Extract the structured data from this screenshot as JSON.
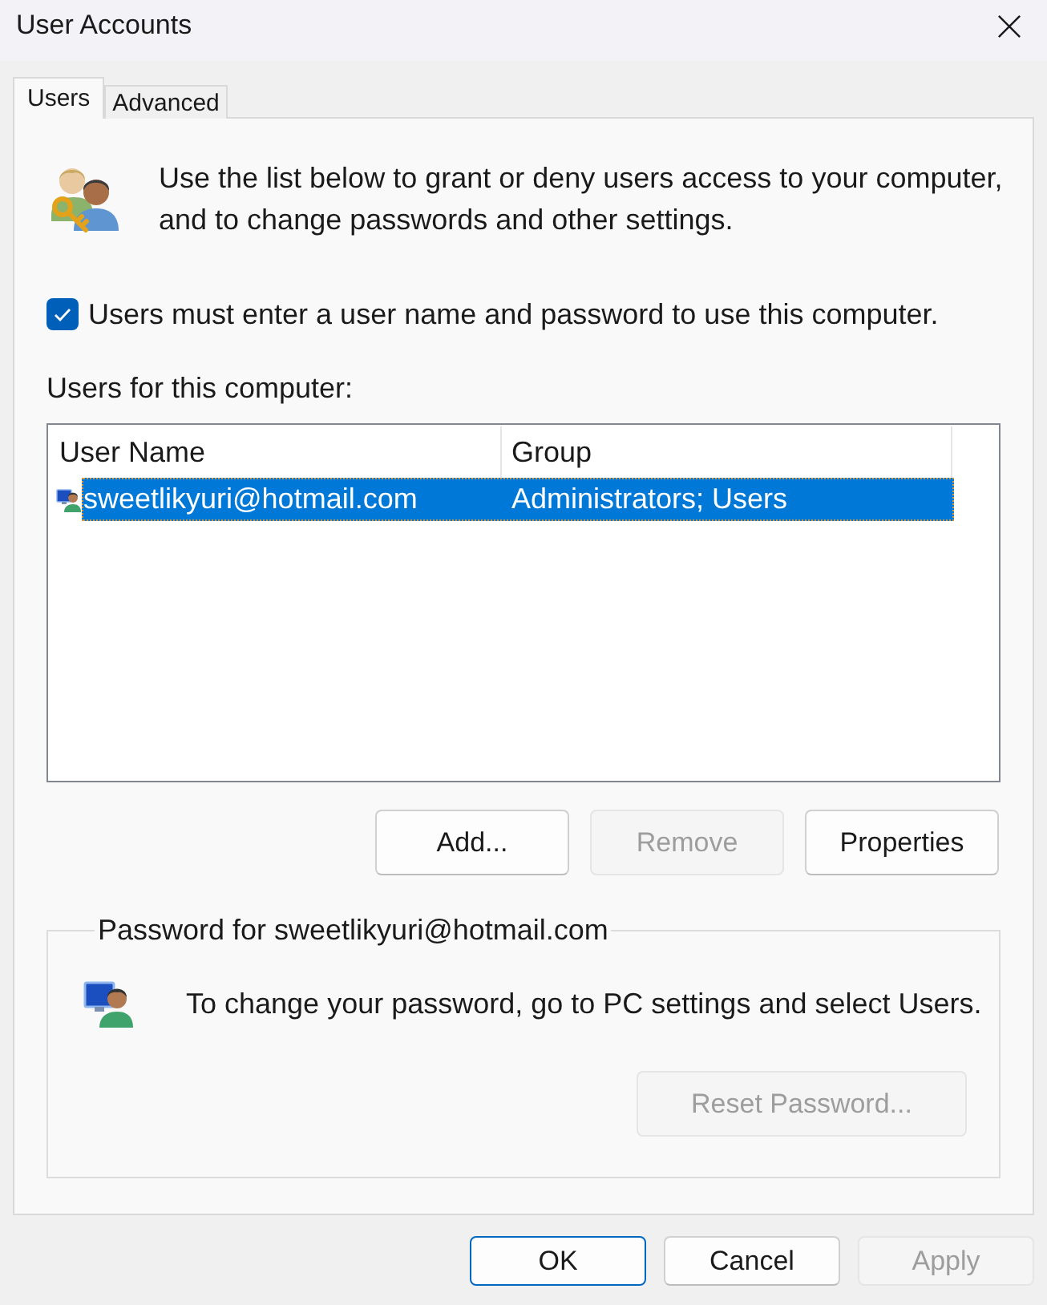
{
  "window": {
    "title": "User Accounts"
  },
  "tabs": [
    {
      "label": "Users",
      "selected": true
    },
    {
      "label": "Advanced",
      "selected": false
    }
  ],
  "intro": {
    "text": "Use the list below to grant or deny users access to your computer, and to change passwords and other settings."
  },
  "login_required": {
    "label": "Users must enter a user name and password to use this computer.",
    "checked": true
  },
  "users_label": "Users for this computer:",
  "user_list": {
    "columns": [
      "User Name",
      "Group"
    ],
    "rows": [
      {
        "cells": [
          "sweetlikyuri@hotmail.com",
          "Administrators; Users"
        ],
        "selected": true
      }
    ]
  },
  "list_buttons": [
    {
      "label": "Add...",
      "disabled": false
    },
    {
      "label": "Remove",
      "disabled": true
    },
    {
      "label": "Properties",
      "disabled": false
    }
  ],
  "password_group": {
    "title": "Password for sweetlikyuri@hotmail.com",
    "text": "To change your password, go to PC settings and select Users.",
    "button": {
      "label": "Reset Password...",
      "disabled": true
    }
  },
  "dialog_buttons": [
    {
      "label": "OK",
      "disabled": false,
      "default": true
    },
    {
      "label": "Cancel",
      "disabled": false,
      "default": false
    },
    {
      "label": "Apply",
      "disabled": true,
      "default": false
    }
  ]
}
